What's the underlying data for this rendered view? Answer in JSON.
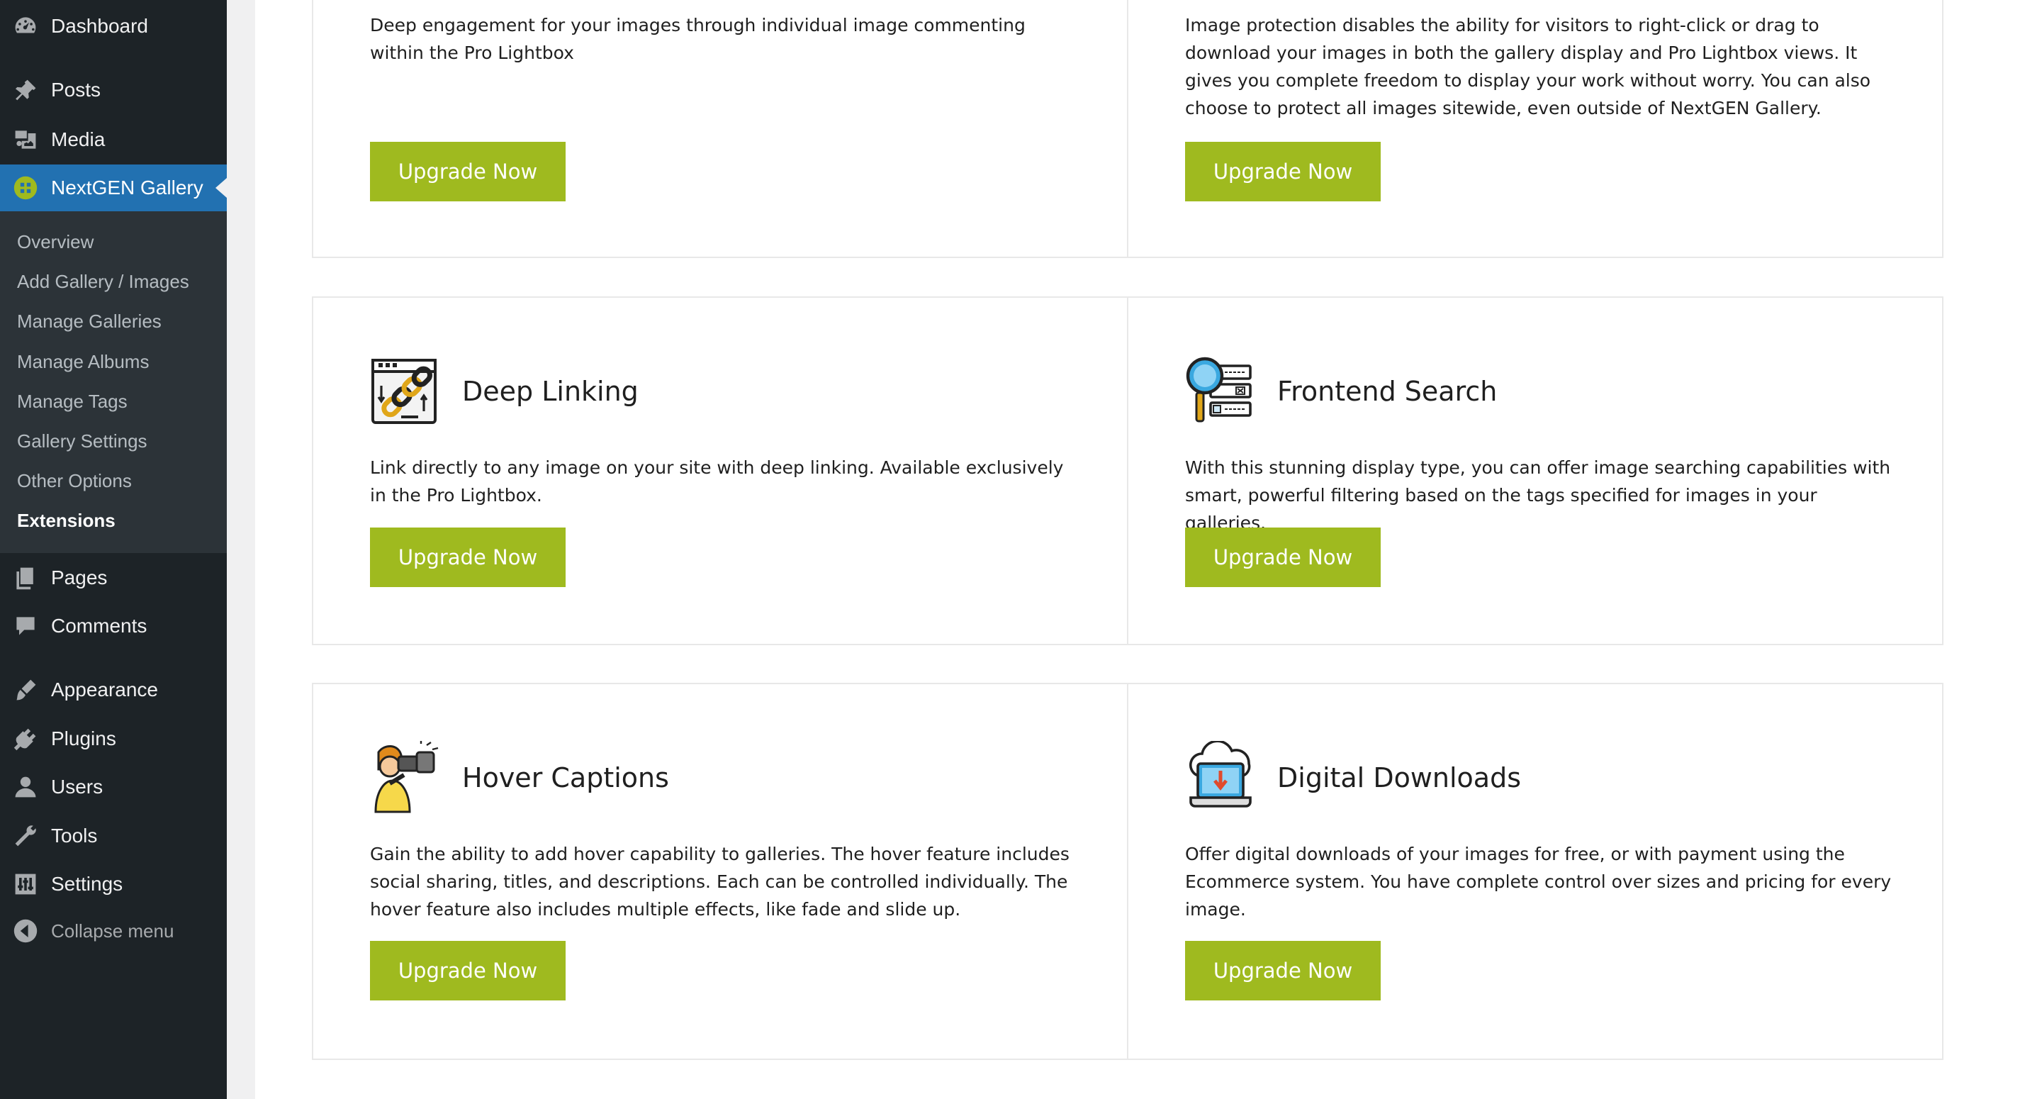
{
  "sidebar": {
    "top_items": [
      {
        "label": "Dashboard",
        "icon": "dashboard-icon"
      },
      {
        "label": "Posts",
        "icon": "pushpin-icon"
      },
      {
        "label": "Media",
        "icon": "media-icon"
      },
      {
        "label": "NextGEN Gallery",
        "icon": "nextgen-logo-icon",
        "current": true
      }
    ],
    "submenu": [
      {
        "label": "Overview"
      },
      {
        "label": "Add Gallery / Images"
      },
      {
        "label": "Manage Galleries"
      },
      {
        "label": "Manage Albums"
      },
      {
        "label": "Manage Tags"
      },
      {
        "label": "Gallery Settings"
      },
      {
        "label": "Other Options"
      },
      {
        "label": "Extensions",
        "active": true
      }
    ],
    "bottom_items": [
      {
        "label": "Pages",
        "icon": "pages-icon"
      },
      {
        "label": "Comments",
        "icon": "comment-bubble-icon"
      },
      {
        "label": "Appearance",
        "icon": "paintbrush-icon"
      },
      {
        "label": "Plugins",
        "icon": "plug-icon"
      },
      {
        "label": "Users",
        "icon": "user-icon"
      },
      {
        "label": "Tools",
        "icon": "wrench-icon"
      },
      {
        "label": "Settings",
        "icon": "sliders-icon"
      }
    ],
    "collapse_label": "Collapse menu",
    "colors": {
      "bg": "#1d2327",
      "submenu_bg": "#2c3338",
      "current_bg": "#2271b1"
    }
  },
  "cards": [
    {
      "title": "",
      "description": "Deep engagement for your images through individual image commenting within the Pro Lightbox",
      "button": "Upgrade Now"
    },
    {
      "title": "",
      "description": "Image protection disables the ability for visitors to right-click or drag to download your images in both the gallery display and Pro Lightbox views. It gives you complete freedom to display your work without worry. You can also choose to protect all images sitewide, even outside of NextGEN Gallery.",
      "button": "Upgrade Now"
    },
    {
      "title": "Deep Linking",
      "icon": "chain-link-icon",
      "description": "Link directly to any image on your site with deep linking. Available exclusively in the Pro Lightbox.",
      "button": "Upgrade Now"
    },
    {
      "title": "Frontend Search",
      "icon": "magnifier-filter-icon",
      "description": "With this stunning display type, you can offer image searching capabilities with smart, powerful filtering based on the tags specified for images in your galleries.",
      "button": "Upgrade Now"
    },
    {
      "title": "Hover Captions",
      "icon": "binoculars-person-icon",
      "description": "Gain the ability to add hover capability to galleries. The hover feature includes social sharing, titles, and descriptions. Each can be controlled individually. The hover feature also includes multiple effects, like fade and slide up.",
      "button": "Upgrade Now"
    },
    {
      "title": "Digital Downloads",
      "icon": "cloud-download-laptop-icon",
      "description": "Offer digital downloads of your images for free, or with payment using the Ecommerce system. You have complete control over sizes and pricing for every image.",
      "button": "Upgrade Now"
    }
  ],
  "accent_color": "#9fba1f"
}
